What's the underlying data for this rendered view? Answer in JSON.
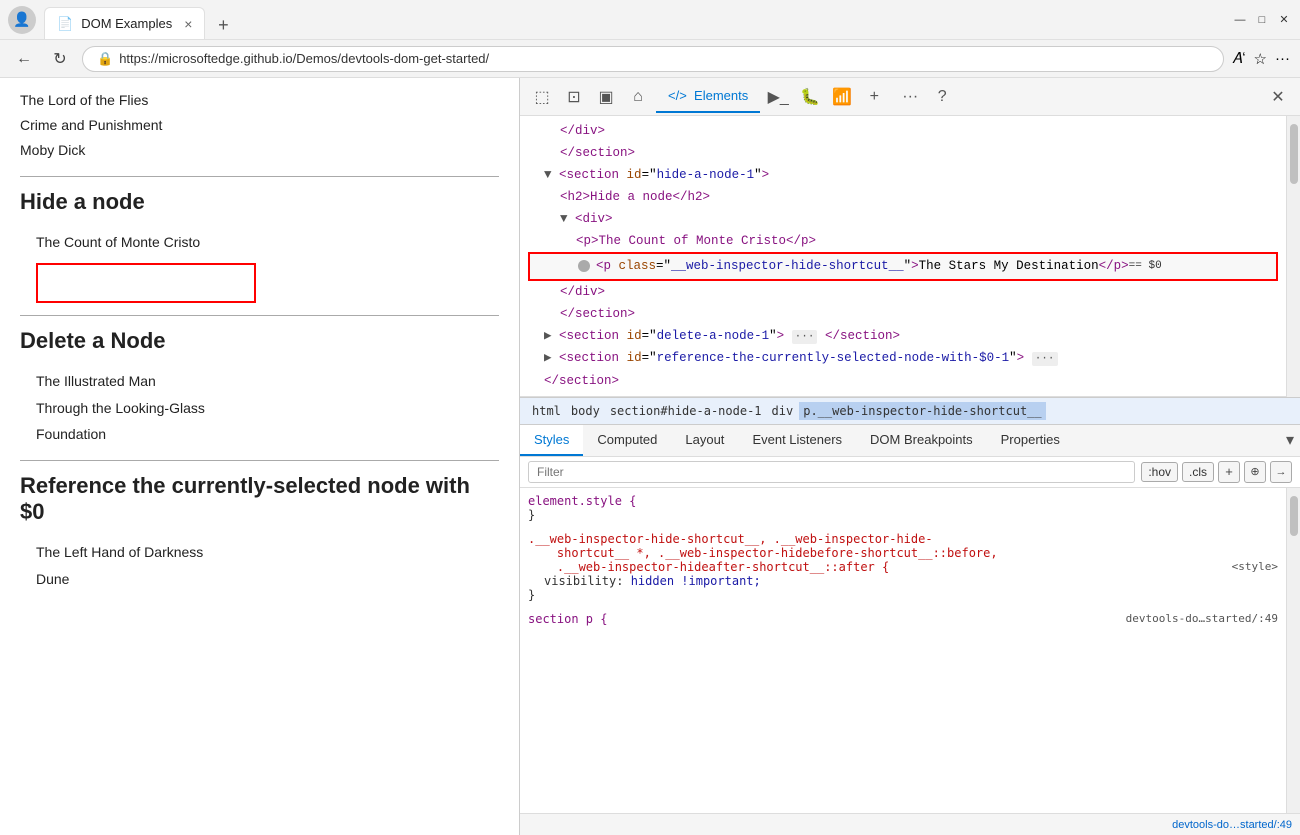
{
  "browser": {
    "title": "DOM Examples",
    "url": "https://microsoftedge.github.io/Demos/devtools-dom-get-started/",
    "tab_close": "×",
    "tab_new": "+",
    "nav_back": "←",
    "nav_reload": "↻",
    "lock_icon": "🔒"
  },
  "page": {
    "books_top": [
      "The Lord of the Flies",
      "Crime and Punishment",
      "Moby Dick"
    ],
    "section_hide": {
      "title": "Hide a node",
      "books": [
        "The Count of Monte Cristo"
      ]
    },
    "section_delete": {
      "title": "Delete a Node",
      "books": [
        "The Illustrated Man",
        "Through the Looking-Glass",
        "Foundation"
      ]
    },
    "section_reference": {
      "title": "Reference the currently-selected node with $0",
      "books": [
        "The Left Hand of Darkness",
        "Dune"
      ]
    }
  },
  "devtools": {
    "toolbar_tabs": [
      "Elements"
    ],
    "active_tab": "Elements",
    "dom_lines": [
      {
        "indent": 2,
        "content": "</div>",
        "type": "tag"
      },
      {
        "indent": 2,
        "content": "</section>",
        "type": "tag"
      },
      {
        "indent": 1,
        "content": "<section id=\"hide-a-node-1\">",
        "type": "open"
      },
      {
        "indent": 2,
        "content": "<h2>Hide a node</h2>",
        "type": "tag"
      },
      {
        "indent": 2,
        "content": "▼ <div>",
        "type": "open"
      },
      {
        "indent": 3,
        "content": "<p>The Count of Monte Cristo</p>",
        "type": "tag"
      },
      {
        "indent": 3,
        "content": "<p class=\"__web-inspector-hide-shortcut__\">The Stars My Destination</p> == $0",
        "type": "selected"
      },
      {
        "indent": 2,
        "content": "</div>",
        "type": "tag"
      },
      {
        "indent": 2,
        "content": "</section>",
        "type": "tag"
      },
      {
        "indent": 1,
        "content": "▶ <section id=\"delete-a-node-1\"> … </section>",
        "type": "collapsed"
      },
      {
        "indent": 1,
        "content": "▶ <section id=\"reference-the-currently-selected-node-with-$0-1\"> …",
        "type": "collapsed"
      },
      {
        "indent": 1,
        "content": "</section>",
        "type": "tag"
      }
    ],
    "breadcrumb": [
      "html",
      "body",
      "section#hide-a-node-1",
      "div",
      "p.__web-inspector-hide-shortcut__"
    ],
    "breadcrumb_active": "p.__web-inspector-hide-shortcut__",
    "styles_tabs": [
      "Styles",
      "Computed",
      "Layout",
      "Event Listeners",
      "DOM Breakpoints",
      "Properties"
    ],
    "active_style_tab": "Styles",
    "filter_placeholder": "Filter",
    "filter_buttons": [
      ":hov",
      ".cls"
    ],
    "style_rules": [
      {
        "selector": "element.style {",
        "close": "}",
        "props": [],
        "source": ""
      },
      {
        "selector": ".__web-inspector-hide-shortcut__, .__web-inspector-hide-shortcut__ *, .__web-inspector-hidebefore-shortcut__::before, .__web-inspector-hideafter-shortcut__::after {",
        "close": "}",
        "props": [
          {
            "name": "visibility",
            "value": "hidden !important;"
          }
        ],
        "source": "<style>"
      },
      {
        "selector": "section p {",
        "close": "",
        "props": [],
        "source": "devtools-do…started/:49"
      }
    ],
    "status_right": "devtools-do…started/:49"
  },
  "icons": {
    "inspect": "⬚",
    "device": "📱",
    "sidebar": "▣",
    "home": "⌂",
    "elements": "</>",
    "console": "▶",
    "bug": "🐛",
    "network": "📶",
    "plus_tab": "+",
    "more": "···",
    "help": "?",
    "close_dt": "✕",
    "minimize": "—",
    "maximize": "□",
    "close_win": "✕"
  }
}
